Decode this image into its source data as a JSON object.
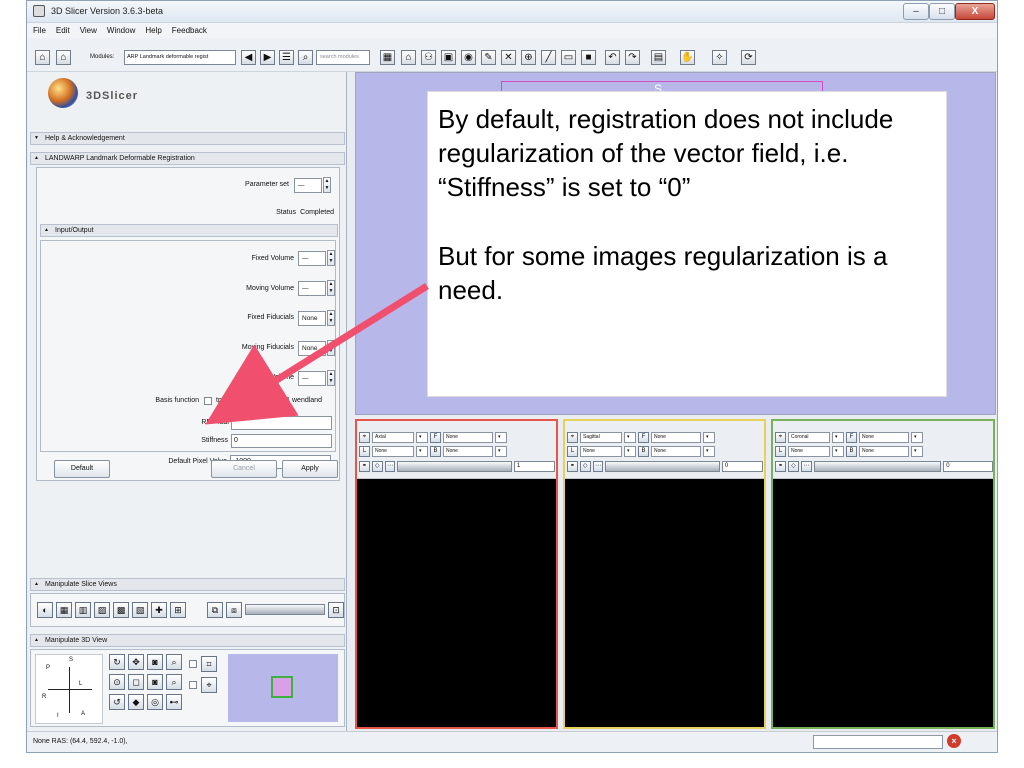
{
  "window": {
    "title": "3D Slicer Version 3.6.3-beta",
    "controls": [
      "–",
      "□",
      "X"
    ]
  },
  "menu": [
    "File",
    "Edit",
    "View",
    "Window",
    "Help",
    "Feedback"
  ],
  "toolbar": {
    "modules_label": "Modules:",
    "module_selected": "ARP Landmark deformable regist",
    "search_placeholder": "search modules"
  },
  "leftpanel": {
    "brand": "3DSlicer",
    "help_section": "Help & Acknowledgement",
    "module_section": "LANDWARP Landmark Deformable Registration",
    "parameter_set_label": "Parameter set",
    "status_label": "Status",
    "status_value": "Completed",
    "io_section": "Input/Output",
    "fixed_volume_label": "Fixed Volume",
    "moving_volume_label": "Moving Volume",
    "fixed_fiducials_label": "Fixed Fiducials",
    "fixed_fiducials_value": "None",
    "moving_fiducials_label": "Moving Fiducials",
    "moving_fiducials_value": "None",
    "output_volume_label": "Output Volume",
    "basis_function_label": "Basis function",
    "basis_options": [
      "tps",
      "wendland"
    ],
    "rbf_label": "RBF radi",
    "stiffness_label": "Stiffness",
    "stiffness_value": "0",
    "default_pixel_label": "Default Pixel Value",
    "default_pixel_value": "-1000",
    "default_button": "Default",
    "cancel_button": "Cancel",
    "apply_button": "Apply",
    "manip_slice_section": "Manipulate Slice Views",
    "manip_3d_section": "Manipulate 3D View",
    "axis_labels": [
      "P",
      "S",
      "R",
      "L",
      "I",
      "A"
    ]
  },
  "status": {
    "ras": "None RAS: (64.4, 592.4, -1.0),"
  },
  "view3d": {
    "label": "S"
  },
  "slices": [
    {
      "orientation": "Axial",
      "fg": "None",
      "bg": "None",
      "label": "None",
      "label2": "None",
      "offset": "1",
      "color": "#e7544a"
    },
    {
      "orientation": "Sagittal",
      "fg": "None",
      "bg": "None",
      "label": "None",
      "label2": "None",
      "offset": "0",
      "color": "#e6d25a"
    },
    {
      "orientation": "Coronal",
      "fg": "None",
      "bg": "None",
      "label": "None",
      "label2": "None",
      "offset": "0",
      "color": "#77b25a"
    }
  ],
  "callout": {
    "paragraph1": "By default, registration does not include regularization of the vector field, i.e. “Stiffness” is set to “0”",
    "paragraph2": "But for some images regularization is a need."
  },
  "accent": {
    "arrow": "#f0506e",
    "view_bg": "#b7b8e9"
  }
}
